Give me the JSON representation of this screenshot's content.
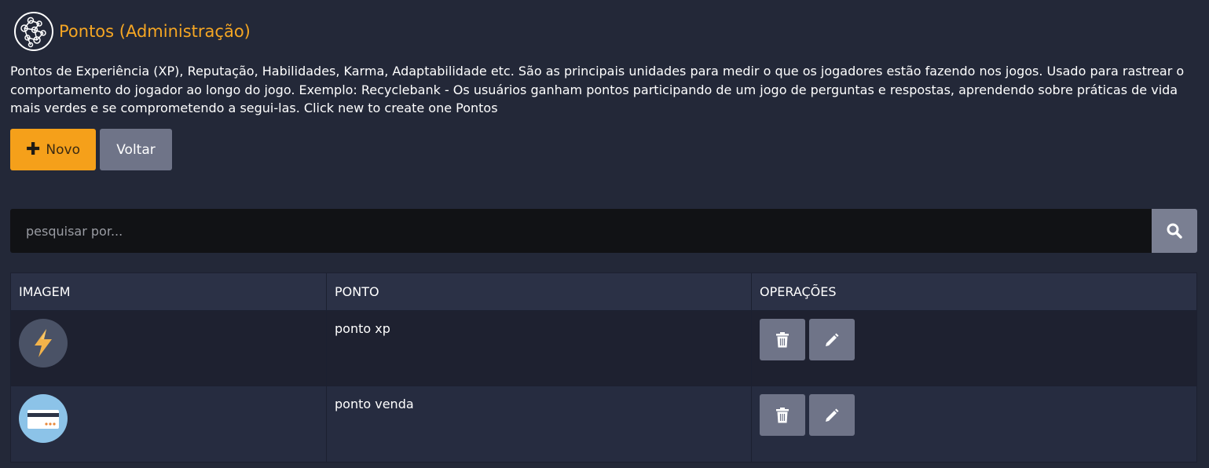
{
  "header": {
    "title": "Pontos (Administração)",
    "logo_icon": "globe-network-icon"
  },
  "description": "Pontos de Experiência (XP), Reputação, Habilidades, Karma, Adaptabilidade etc. São as principais unidades para medir o que os jogadores estão fazendo nos jogos. Usado para rastrear o comportamento do jogador ao longo do jogo. Exemplo: Recyclebank - Os usuários ganham pontos participando de um jogo de perguntas e respostas, aprendendo sobre práticas de vida mais verdes e se comprometendo a segui-las. Click new to create one Pontos",
  "toolbar": {
    "new_label": "Novo",
    "new_icon": "plus-icon",
    "back_label": "Voltar"
  },
  "search": {
    "placeholder": "pesquisar por...",
    "value": "",
    "icon": "search-icon"
  },
  "table": {
    "columns": [
      "IMAGEM",
      "PONTO",
      "OPERAÇÕES"
    ],
    "rows": [
      {
        "image_icon": "lightning-bolt-icon",
        "point": "ponto xp"
      },
      {
        "image_icon": "credit-card-icon",
        "point": "ponto venda"
      }
    ],
    "operations": [
      "trash-icon",
      "pencil-icon"
    ]
  },
  "colors": {
    "background": "#232838",
    "accent": "#f5a623",
    "button_gray": "#6f7488",
    "table_header": "#2b3146"
  }
}
